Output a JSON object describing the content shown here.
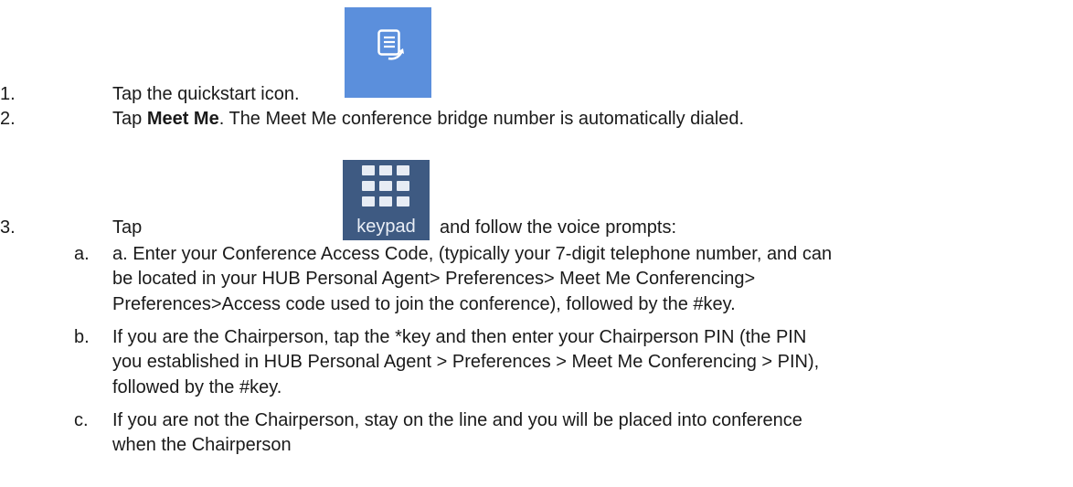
{
  "steps": [
    {
      "number": "1.",
      "text": "Tap the quickstart icon."
    },
    {
      "number": "2.",
      "prefix": "Tap ",
      "bold": "Meet Me",
      "suffix": ". The Meet Me conference bridge number is automatically dialed."
    },
    {
      "number": "3.",
      "prefix": "Tap",
      "suffix": "and follow the voice prompts:"
    }
  ],
  "substeps": [
    {
      "letter": "a.",
      "lines": [
        "a. Enter your Conference Access Code, (typically your 7-digit telephone number, and can",
        "be located in your HUB Personal Agent> Preferences> Meet Me Conferencing>",
        "Preferences>Access code used to join the conference), followed by the #key."
      ]
    },
    {
      "letter": "b.",
      "lines": [
        "If you are the Chairperson, tap the *key and then enter your Chairperson PIN (the PIN",
        "you established in HUB Personal Agent > Preferences > Meet Me Conferencing > PIN),",
        "followed by the #key."
      ]
    },
    {
      "letter": "c.",
      "lines": [
        "If you are not the Chairperson, stay on the line and you will be placed into conference",
        "when the Chairperson"
      ]
    }
  ],
  "icons": {
    "quickstart": {
      "name": "quickstart-icon",
      "color": "#5b8fdc"
    },
    "keypad": {
      "name": "keypad-icon",
      "label": "keypad",
      "color": "#3e5a82"
    }
  }
}
